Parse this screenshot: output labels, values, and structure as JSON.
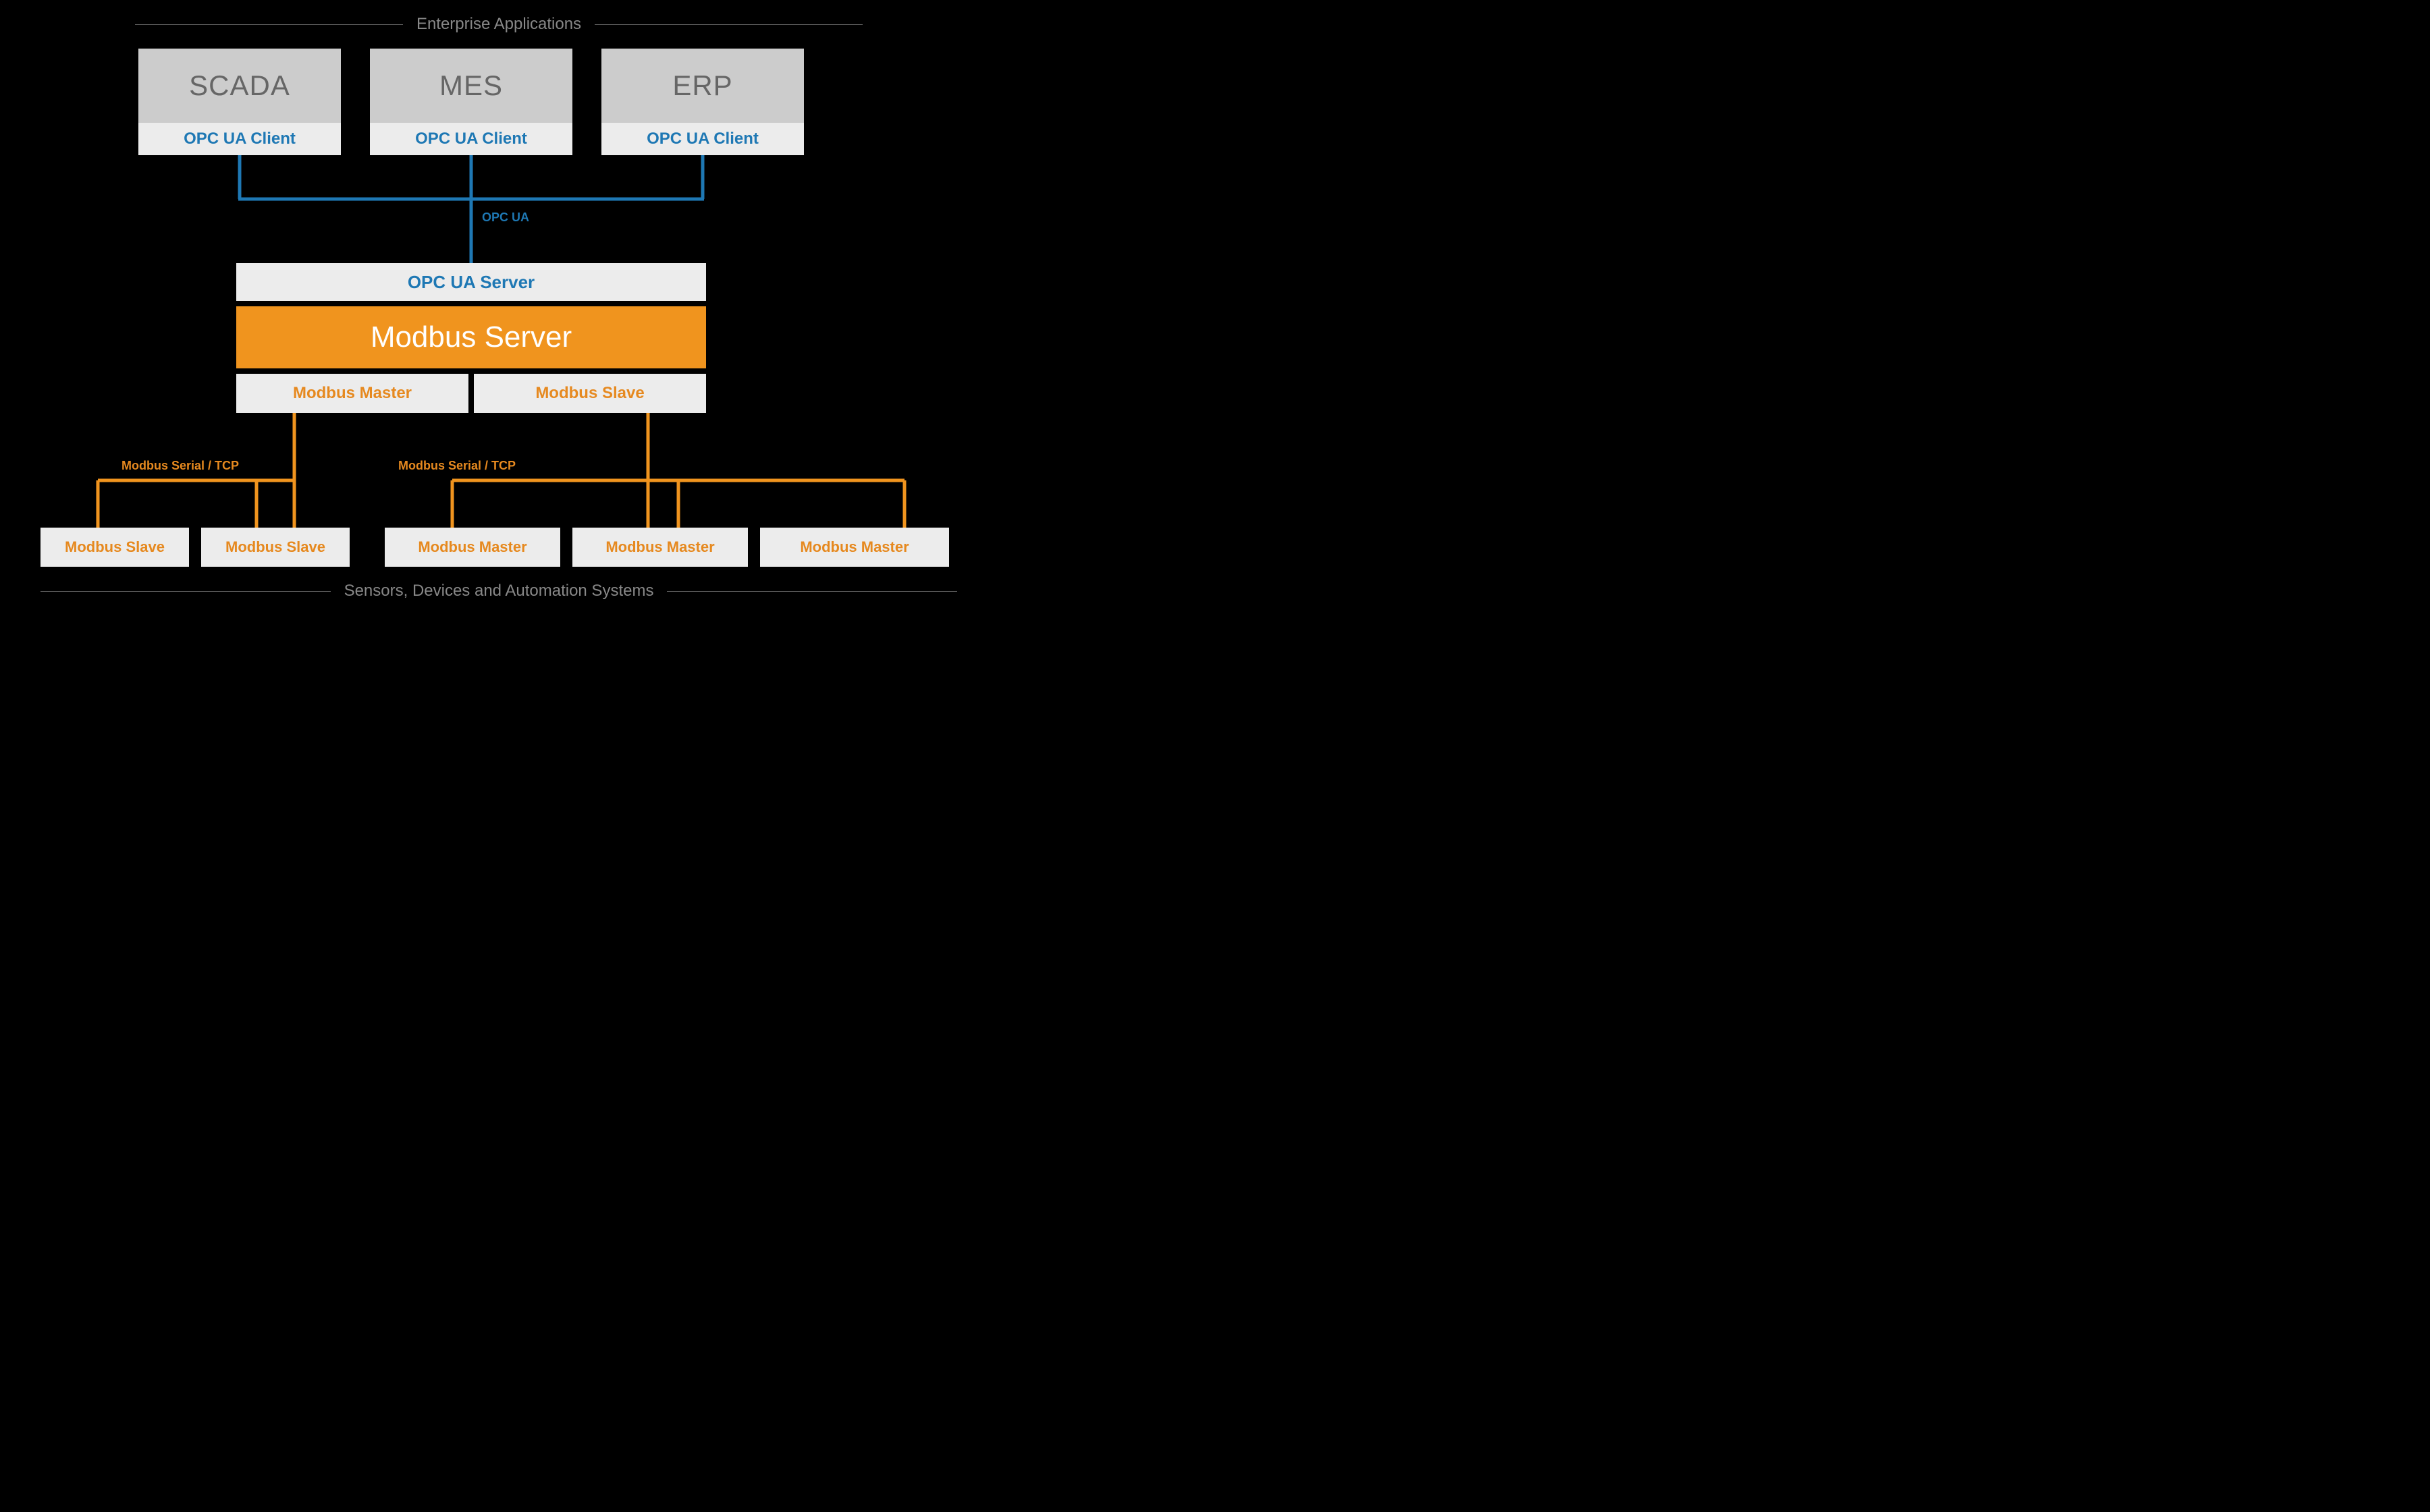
{
  "sections": {
    "top": "Enterprise Applications",
    "bottom": "Sensors, Devices and Automation Systems"
  },
  "apps": [
    {
      "name": "SCADA",
      "client": "OPC UA Client"
    },
    {
      "name": "MES",
      "client": "OPC UA Client"
    },
    {
      "name": "ERP",
      "client": "OPC UA Client"
    }
  ],
  "opc_link_label": "OPC UA",
  "server_stack": {
    "opc_server": "OPC UA Server",
    "modbus_server": "Modbus Server",
    "master": "Modbus Master",
    "slave": "Modbus Slave"
  },
  "modbus_link_label_left": "Modbus Serial / TCP",
  "modbus_link_label_right": "Modbus Serial / TCP",
  "bottom_left": [
    "Modbus Slave",
    "Modbus Slave"
  ],
  "bottom_right": [
    "Modbus Master",
    "Modbus Master",
    "Modbus Master"
  ],
  "colors": {
    "blue": "#1e78b4",
    "orange": "#f0941e",
    "orange_text": "#e6891f"
  }
}
